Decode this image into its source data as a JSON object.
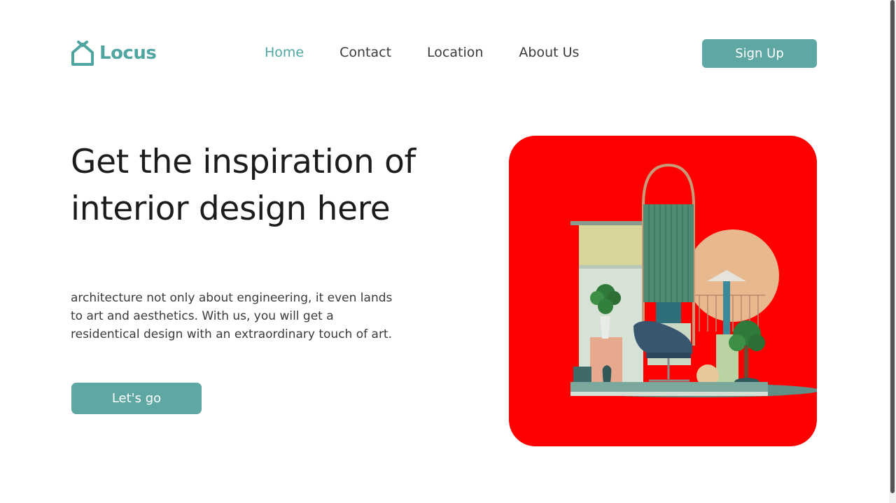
{
  "brand": {
    "name": "Locus",
    "color": "#4fa5a0",
    "icon": "house-icon"
  },
  "nav": {
    "items": [
      {
        "label": "Home",
        "active": true
      },
      {
        "label": "Contact",
        "active": false
      },
      {
        "label": "Location",
        "active": false
      },
      {
        "label": "About Us",
        "active": false
      }
    ]
  },
  "header": {
    "signup_label": "Sign Up"
  },
  "hero": {
    "title": "Get the inspiration of interior design here",
    "description": "architecture not only about engineering, it even lands to art and aesthetics. With us, you will get a residentical design with an extraordinary touch of art.",
    "cta_label": "Let's go",
    "image_background": "#ff0000"
  },
  "colors": {
    "accent": "#5ea7a2",
    "text": "#1c1c1c"
  }
}
